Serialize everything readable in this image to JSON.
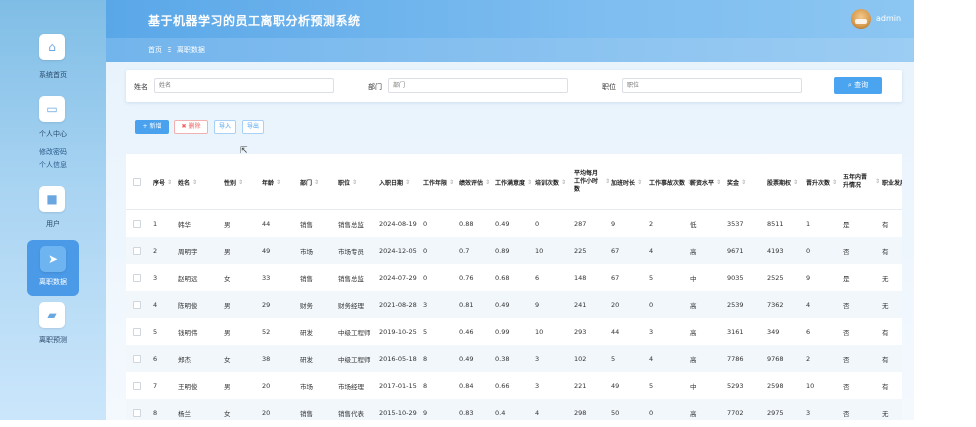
{
  "header": {
    "title": "基于机器学习的员工离职分析预测系统",
    "username": "admin"
  },
  "breadcrumb": {
    "home": "首页",
    "separator": "Ξ",
    "current": "离职数据"
  },
  "sidebar": {
    "items": [
      {
        "label": "系统首页",
        "icon": "home-icon"
      },
      {
        "label": "个人中心",
        "icon": "wallet-icon"
      },
      {
        "label": "用户",
        "icon": "square-icon"
      },
      {
        "label": "离职数据",
        "icon": "send-icon",
        "active": true
      },
      {
        "label": "离职预测",
        "icon": "briefcase-icon"
      }
    ],
    "submenu": [
      "修改密码",
      "个人信息"
    ]
  },
  "search": {
    "name_label": "姓名",
    "name_placeholder": "姓名",
    "dept_label": "部门",
    "dept_placeholder": "部门",
    "position_label": "职位",
    "position_placeholder": "职位",
    "query_button": "查询"
  },
  "actions": {
    "add": "+ 新增",
    "delete": "✖ 删除",
    "import": "导入",
    "export": "导出"
  },
  "table": {
    "columns": [
      "序号",
      "姓名",
      "性别",
      "年龄",
      "部门",
      "职位",
      "入职日期",
      "工作年限",
      "绩效评估",
      "工作满意度",
      "培训次数",
      "平均每月工作小时数",
      "加班时长",
      "工作事故次数",
      "薪资水平",
      "奖金",
      "股票期权",
      "晋升次数",
      "五年内晋升情况",
      "职业发展"
    ],
    "rows": [
      [
        "1",
        "韩华",
        "男",
        "44",
        "销售",
        "销售总监",
        "2024-08-19",
        "0",
        "0.88",
        "0.49",
        "0",
        "287",
        "9",
        "2",
        "低",
        "3537",
        "8511",
        "1",
        "是",
        "有"
      ],
      [
        "2",
        "周明宇",
        "男",
        "49",
        "市场",
        "市场专员",
        "2024-12-05",
        "0",
        "0.7",
        "0.89",
        "10",
        "225",
        "67",
        "4",
        "高",
        "9671",
        "4193",
        "0",
        "否",
        "有"
      ],
      [
        "3",
        "赵明远",
        "女",
        "33",
        "销售",
        "销售总监",
        "2024-07-29",
        "0",
        "0.76",
        "0.68",
        "6",
        "148",
        "67",
        "5",
        "中",
        "9035",
        "2525",
        "9",
        "是",
        "无"
      ],
      [
        "4",
        "陈明俊",
        "男",
        "29",
        "财务",
        "财务经理",
        "2021-08-28",
        "3",
        "0.81",
        "0.49",
        "9",
        "241",
        "20",
        "0",
        "高",
        "2539",
        "7362",
        "4",
        "否",
        "无"
      ],
      [
        "5",
        "钱明伟",
        "男",
        "52",
        "研发",
        "中级工程师",
        "2019-10-25",
        "5",
        "0.46",
        "0.99",
        "10",
        "293",
        "44",
        "3",
        "高",
        "3161",
        "349",
        "6",
        "否",
        "有"
      ],
      [
        "6",
        "郑杰",
        "女",
        "38",
        "研发",
        "中级工程师",
        "2016-05-18",
        "8",
        "0.49",
        "0.38",
        "3",
        "102",
        "5",
        "4",
        "高",
        "7786",
        "9768",
        "2",
        "否",
        "有"
      ],
      [
        "7",
        "王明俊",
        "男",
        "20",
        "市场",
        "市场经理",
        "2017-01-15",
        "8",
        "0.84",
        "0.66",
        "3",
        "221",
        "49",
        "5",
        "中",
        "5293",
        "2598",
        "10",
        "否",
        "有"
      ],
      [
        "8",
        "杨兰",
        "女",
        "20",
        "销售",
        "销售代表",
        "2015-10-29",
        "9",
        "0.83",
        "0.4",
        "4",
        "298",
        "50",
        "0",
        "高",
        "7702",
        "2975",
        "3",
        "否",
        "无"
      ]
    ]
  }
}
